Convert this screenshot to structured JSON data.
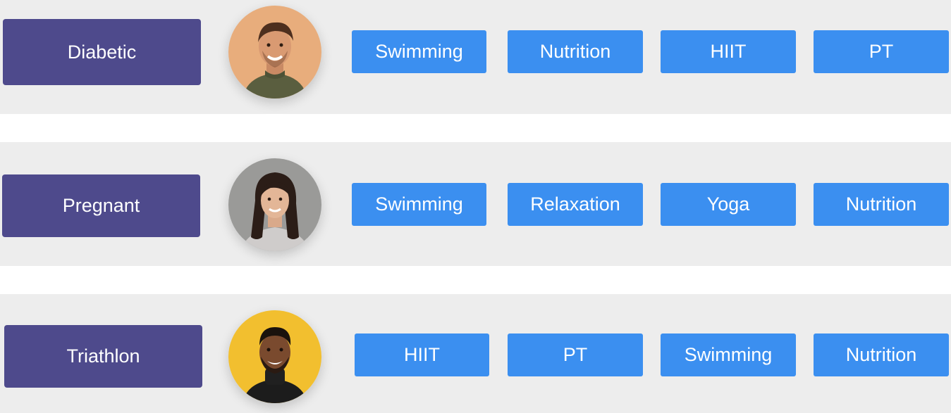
{
  "rows": [
    {
      "segment": "Diabetic",
      "avatar_icon": "man-brown-hair-green-sweater-photo",
      "avatar_bg": "#e8ad7c",
      "tags": [
        "Swimming",
        "Nutrition",
        "HIIT",
        "PT"
      ]
    },
    {
      "segment": "Pregnant",
      "avatar_icon": "woman-dark-hair-grey-sweater-photo",
      "avatar_bg": "#9a9a98",
      "tags": [
        "Swimming",
        "Relaxation",
        "Yoga",
        "Nutrition"
      ]
    },
    {
      "segment": "Triathlon",
      "avatar_icon": "man-smiling-black-turtleneck-photo",
      "avatar_bg": "#f2bf2f",
      "tags": [
        "HIIT",
        "PT",
        "Swimming",
        "Nutrition"
      ]
    }
  ],
  "colors": {
    "row_background": "#ededed",
    "segment_button": "#4e4a8c",
    "tag_button": "#3b8ff0",
    "text": "#ffffff"
  }
}
